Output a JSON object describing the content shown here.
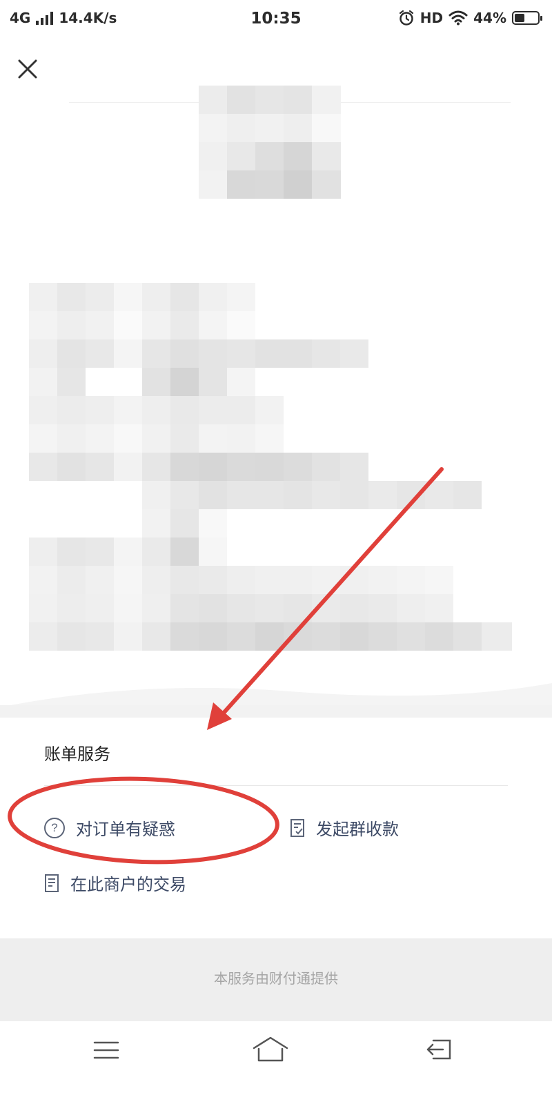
{
  "status_bar": {
    "network": "4G",
    "speed": "14.4K/s",
    "time": "10:35",
    "quality": "HD",
    "battery": "44%",
    "battery_level": 0.44,
    "icons": [
      "signal-icon",
      "alarm-icon",
      "wifi-icon",
      "battery-icon"
    ]
  },
  "header": {
    "close_icon": "close-icon"
  },
  "bill_service": {
    "title": "账单服务",
    "items": [
      {
        "label": "对订单有疑惑",
        "icon": "question-circle-icon"
      },
      {
        "label": "发起群收款",
        "icon": "document-check-icon"
      },
      {
        "label": "在此商户的交易",
        "icon": "document-list-icon"
      }
    ]
  },
  "footer": {
    "text": "本服务由财付通提供"
  },
  "nav_bar": {
    "icons": [
      "menu-icon",
      "home-icon",
      "back-icon"
    ]
  },
  "annotation": {
    "color": "#e0403a"
  }
}
